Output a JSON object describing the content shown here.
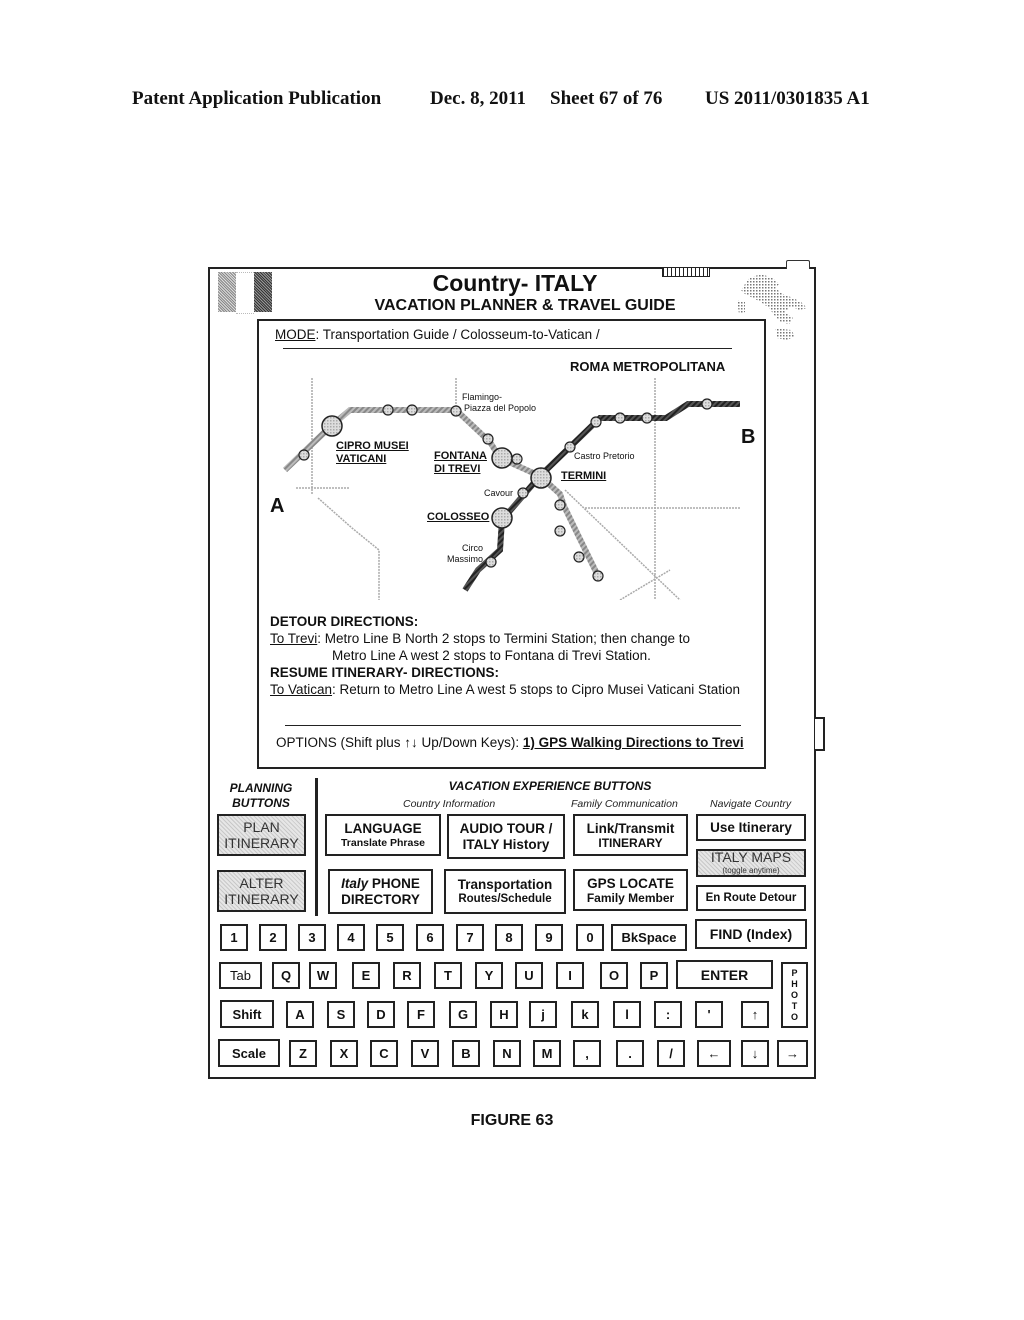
{
  "patent_header": {
    "publication": "Patent Application Publication",
    "date": "Dec. 8, 2011",
    "sheet": "Sheet 67 of 76",
    "number": "US 2011/0301835 A1"
  },
  "device": {
    "title": "Country- ITALY",
    "subtitle": "VACATION PLANNER & TRAVEL GUIDE",
    "flag_icon": "italy-flag-icon",
    "battery_icon": "battery-icon",
    "map_icon": "italy-map-icon"
  },
  "screen": {
    "mode_label": "MODE",
    "mode_value": ": Transportation Guide / Colosseum-to-Vatican /",
    "map_title": "ROMA METROPOLITANA",
    "point_a": "A",
    "point_b": "B",
    "stations": {
      "cipro_1": "CIPRO MUSEI",
      "cipro_2": "VATICANI",
      "flaminio_1": "Flamingo-",
      "flaminio_2": "Piazza del Popolo",
      "trevi_1": "FONTANA",
      "trevi_2": "DI TREVI",
      "castro": "Castro Pretorio",
      "termini": "TERMINI",
      "cavour": "Cavour",
      "colosseo": "COLOSSEO",
      "circo_1": "Circo",
      "circo_2": "Massimo"
    },
    "detour_heading": "DETOUR DIRECTIONS",
    "detour_to_label": "To Trevi",
    "detour_line1": ":  Metro Line B North 2 stops to Termini Station; then change to",
    "detour_line2": "Metro Line A west 2 stops to Fontana di Trevi Station.",
    "resume_heading": "RESUME ITINERARY- DIRECTIONS:",
    "resume_to_label": "To Vatican",
    "resume_line": ": Return to Metro Line A west 5 stops to Cipro Musei Vaticani Station",
    "options_prefix": "OPTIONS (Shift plus ↑↓ Up/Down Keys): ",
    "options_link": "1) GPS Walking Directions to Trevi"
  },
  "planning": {
    "heading_1": "PLANNING",
    "heading_2": "BUTTONS",
    "buttons": [
      {
        "l1": "PLAN",
        "l2": "ITINERARY"
      },
      {
        "l1": "ALTER",
        "l2": "ITINERARY"
      }
    ]
  },
  "vacation": {
    "heading": "VACATION EXPERIENCE BUTTONS",
    "categories": [
      "Country Information",
      "Family Communication",
      "Navigate Country"
    ],
    "buttons": {
      "language": {
        "l1": "LANGUAGE",
        "l2": "Translate Phrase"
      },
      "audio": {
        "l1": "AUDIO TOUR /",
        "l2": "ITALY History"
      },
      "link": {
        "l1": "Link/Transmit",
        "l2": "ITINERARY"
      },
      "use_itinerary": {
        "l1": "Use Itinerary"
      },
      "italy_maps": {
        "l1": "ITALY MAPS",
        "l2": "(toggle anytime)"
      },
      "phone_italic": "Italy",
      "phone_l1": " PHONE",
      "phone_l2": "DIRECTORY",
      "transport": {
        "l1": "Transportation",
        "l2": "Routes/Schedule"
      },
      "gps": {
        "l1": "GPS LOCATE",
        "l2": "Family Member"
      },
      "detour": {
        "l1": "En Route Detour"
      }
    }
  },
  "keyboard": {
    "row1": [
      "1",
      "2",
      "3",
      "4",
      "5",
      "6",
      "7",
      "8",
      "9",
      "0"
    ],
    "bkspace": "BkSpace",
    "find": "FIND (Index)",
    "tab": "Tab",
    "row2": [
      "Q",
      "W",
      "E",
      "R",
      "T",
      "Y",
      "U",
      "I",
      "O",
      "P"
    ],
    "enter": "ENTER",
    "photo": [
      "P",
      "H",
      "O",
      "T",
      "O"
    ],
    "shift": "Shift",
    "row3": [
      "A",
      "S",
      "D",
      "F",
      "G",
      "H",
      "j",
      "k",
      "l",
      ":",
      "'",
      "↑"
    ],
    "scale": "Scale",
    "row4": [
      "Z",
      "X",
      "C",
      "V",
      "B",
      "N",
      "M",
      ",",
      ".",
      "/",
      "←",
      "↓",
      "→"
    ]
  },
  "figure_label": "FIGURE 63"
}
